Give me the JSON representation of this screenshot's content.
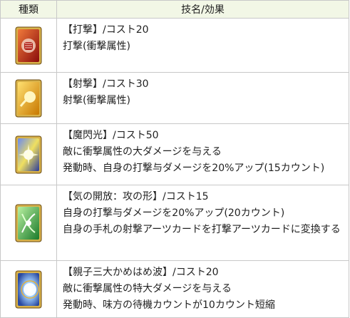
{
  "table": {
    "headers": {
      "type": "種類",
      "skill": "技名/効果"
    },
    "rows": [
      {
        "card_icon": "strike-card-icon",
        "card_color": "#c8281e",
        "lines": [
          "【打撃】/コスト20",
          "打撃(衝撃属性)"
        ]
      },
      {
        "card_icon": "shoot-card-icon",
        "card_color": "#e8a010",
        "lines": [
          "【射撃】/コスト30",
          "射撃(衝撃属性)"
        ]
      },
      {
        "card_icon": "magic-flash-card-icon",
        "card_color": "#3a58c8",
        "lines": [
          "【魔閃光】/コスト50",
          "敵に衝撃属性の大ダメージを与える",
          "発動時、自身の打撃与ダメージを20%アップ(15カウント)"
        ]
      },
      {
        "card_icon": "ki-release-card-icon",
        "card_color": "#3aa040",
        "lines": [
          "【気の開放：攻の形】/コスト15",
          "自身の打撃与ダメージを20%アップ(20カウント)",
          "自身の手札の射撃アーツカードを打撃アーツカードに変換する"
        ]
      },
      {
        "card_icon": "kamehameha-card-icon",
        "card_color": "#5a8ad8",
        "lines": [
          "【親子三大かめはめ波】/コスト20",
          "敵に衝撃属性の特大ダメージを与える",
          "発動時、味方の待機カウントが10カウント短縮"
        ]
      }
    ]
  }
}
